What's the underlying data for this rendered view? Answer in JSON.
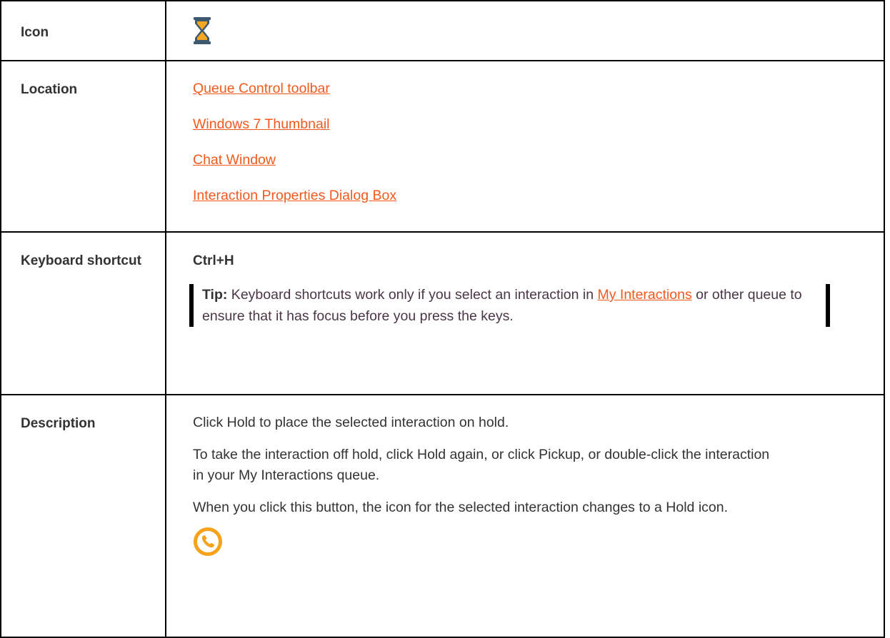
{
  "rows": {
    "icon": {
      "label": "Icon",
      "icon_name": "hourglass-icon"
    },
    "location": {
      "label": "Location",
      "links": [
        "Queue Control toolbar",
        "Windows 7 Thumbnail",
        "Chat Window",
        "Interaction Properties Dialog Box"
      ]
    },
    "keyboard": {
      "label": "Keyboard shortcut",
      "shortcut": "Ctrl+H",
      "tip_label": "Tip:",
      "tip_text_before": " Keyboard shortcuts work only if you select an interaction in ",
      "tip_link": "My Interactions",
      "tip_text_after": " or other queue to ensure that it has focus before you press the keys."
    },
    "description": {
      "label": "Description",
      "paragraphs": [
        "Click Hold to place the selected interaction on hold.",
        "To take the interaction off hold, click Hold again, or click Pickup, or double-click the interaction in your My Interactions queue.",
        "When you click this button, the icon for the selected interaction changes to a Hold icon."
      ],
      "icon_name": "hold-phone-icon"
    }
  },
  "colors": {
    "link": "#f25a1d",
    "border": "#000000",
    "text": "#333333",
    "tip_text": "#4a3646",
    "hourglass_frame": "#3f5a6e",
    "hourglass_sand": "#f5a623",
    "hold_ring": "#f7a21b"
  }
}
